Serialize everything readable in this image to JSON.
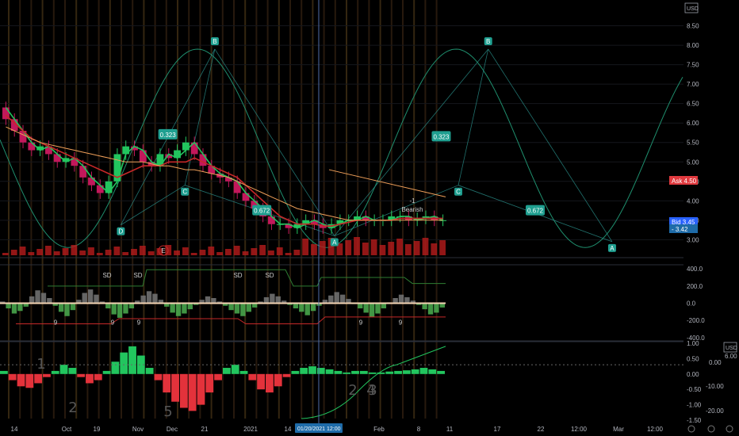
{
  "header": {
    "currency": "USD",
    "pane_currency": "USD"
  },
  "chart_data": [
    {
      "type": "candlestick",
      "pane": "price",
      "ylim": [
        2.6,
        9.0
      ],
      "y_ticks": [
        "8.50",
        "8.00",
        "7.50",
        "7.00",
        "6.50",
        "6.00",
        "5.50",
        "5.00",
        "4.50",
        "4.00",
        "3.50",
        "3.00"
      ],
      "x_ticks": [
        "14",
        "Oct",
        "19",
        "Nov",
        "Dec",
        "21",
        "2021",
        "14",
        "Feb",
        "8",
        "11",
        "17",
        "22",
        "12:00",
        "Mar",
        "12:00"
      ],
      "crosshair_time_label": "01/20/2021 12:00",
      "price_tags": [
        {
          "label": "Ask",
          "value": "4.50",
          "color": "#e0393e"
        },
        {
          "label": "Bid",
          "value": "3.45",
          "color": "#2962ff"
        },
        {
          "label": "",
          "value": "3.42",
          "color": "#1e6ba8"
        }
      ],
      "harmonic_points": [
        {
          "label": "D",
          "x": 0.16,
          "y": 3.38
        },
        {
          "label": "B",
          "x": 0.27,
          "y": 7.9
        },
        {
          "label": "C",
          "x": 0.235,
          "y": 4.4
        },
        {
          "label": "A",
          "x": 0.41,
          "y": 3.1
        },
        {
          "label": "C",
          "x": 0.555,
          "y": 4.4
        },
        {
          "label": "B",
          "x": 0.59,
          "y": 7.9
        },
        {
          "label": "A",
          "x": 0.735,
          "y": 2.95
        }
      ],
      "ratios": [
        {
          "value": "0.323",
          "x": 0.215,
          "y": 5.7
        },
        {
          "value": "0.672",
          "x": 0.325,
          "y": 3.75
        },
        {
          "value": "0.323",
          "x": 0.535,
          "y": 5.65
        },
        {
          "value": "0.672",
          "x": 0.645,
          "y": 3.75
        }
      ],
      "annotations": {
        "bearish_count": "-1",
        "bearish_label": "Bearish",
        "circle_label": "E"
      },
      "series": [
        {
          "name": "",
          "values": [
            6.4,
            6.1,
            5.8,
            5.5,
            5.3,
            5.4,
            5.2,
            5.0,
            5.1,
            4.9,
            4.6,
            4.4,
            4.2,
            4.5,
            5.2,
            5.4,
            5.3,
            5.0,
            4.9,
            5.2,
            5.1,
            5.3,
            5.5,
            5.2,
            4.9,
            4.7,
            4.6,
            4.5,
            4.2,
            4.0,
            3.8,
            3.6,
            3.4,
            3.4,
            3.3,
            3.4,
            3.5,
            3.4,
            3.3,
            3.4,
            3.5,
            3.5,
            3.6,
            3.5,
            3.5,
            3.5,
            3.6,
            3.6,
            3.5,
            3.55,
            3.6,
            3.5
          ]
        },
        {
          "name": "",
          "values": [
            6.2,
            6.0,
            5.8,
            5.6,
            5.5,
            5.4,
            5.3,
            5.2,
            5.1,
            5.0,
            4.9,
            4.8,
            4.7,
            4.6,
            4.7,
            4.8,
            4.9,
            4.9,
            4.9,
            5.0,
            5.0,
            5.0,
            5.1,
            5.0,
            4.9,
            4.8,
            4.7,
            4.6,
            4.4,
            4.2,
            4.0,
            3.8,
            3.6,
            3.5,
            3.4,
            3.4,
            3.4,
            3.35,
            3.35,
            3.4,
            3.45,
            3.5,
            3.5,
            3.5,
            3.5,
            3.5,
            3.55,
            3.55,
            3.55,
            3.55,
            3.55,
            3.55
          ]
        },
        {
          "name": "",
          "values": [
            5.9,
            5.8,
            5.7,
            5.6,
            5.5,
            5.45,
            5.4,
            5.35,
            5.3,
            5.25,
            5.2,
            5.15,
            5.1,
            5.05,
            5.0,
            5.0,
            5.0,
            4.95,
            4.9,
            4.9,
            4.85,
            4.8,
            4.8,
            4.75,
            4.7,
            4.65,
            4.6,
            4.5,
            4.4,
            4.3,
            4.2,
            4.1,
            4.0,
            3.9,
            3.8,
            3.75,
            3.7,
            3.65,
            3.6,
            3.55,
            3.5,
            3.5,
            3.5,
            3.5,
            3.5,
            3.5,
            3.5,
            3.5,
            3.5,
            3.5,
            3.5,
            3.5
          ]
        }
      ]
    },
    {
      "type": "bar",
      "pane": "oscillator",
      "ylim": [
        -420,
        420
      ],
      "y_ticks": [
        "400.0",
        "200.0",
        "0.0",
        "-200.0",
        "-400.0"
      ],
      "signal_labels": [
        "SD",
        "SD",
        "SD",
        "SD",
        "9",
        "9",
        "9",
        "9",
        "9"
      ],
      "values": [
        20,
        -60,
        -120,
        -90,
        -40,
        80,
        150,
        120,
        60,
        -30,
        -100,
        -150,
        -80,
        40,
        120,
        160,
        100,
        20,
        -60,
        -130,
        -170,
        -120,
        -60,
        30,
        90,
        140,
        110,
        40,
        -40,
        -110,
        -150,
        -120,
        -70,
        -20,
        40,
        80,
        60,
        20,
        -30,
        -80,
        -120,
        -150,
        -100,
        -50,
        20,
        70,
        110,
        80,
        30,
        -20,
        -60,
        -100,
        -140,
        -90,
        -30,
        40,
        90,
        130,
        100,
        50,
        -10,
        -60,
        -110,
        -160,
        -120,
        -60,
        10,
        60,
        100,
        70,
        30,
        -20,
        -70,
        -130,
        -110,
        -50
      ]
    },
    {
      "type": "bar",
      "pane": "momentum",
      "ylim": [
        -1.5,
        1.0
      ],
      "y_ticks": [
        "1.00",
        "0.50",
        "0.00",
        "-0.50",
        "-1.00",
        "-1.50"
      ],
      "right_ticks": [
        "0.00",
        "-10.00",
        "-20.00"
      ],
      "right_top_label": "6.00",
      "wave_labels": [
        "1",
        "2",
        "5",
        "2",
        "4",
        "3"
      ],
      "values": [
        0.1,
        -0.2,
        -0.4,
        -0.45,
        -0.3,
        -0.1,
        0.1,
        0.3,
        0.2,
        -0.1,
        -0.3,
        -0.2,
        0.1,
        0.4,
        0.7,
        0.9,
        0.6,
        0.2,
        -0.2,
        -0.6,
        -0.9,
        -1.1,
        -1.2,
        -1.0,
        -0.6,
        -0.2,
        0.2,
        0.3,
        0.1,
        -0.2,
        -0.5,
        -0.6,
        -0.4,
        -0.1,
        0.1,
        0.2,
        0.25,
        0.2,
        0.15,
        0.1,
        0.05,
        0.1,
        0.1,
        0.05,
        0.05,
        0.08,
        0.1,
        0.12,
        0.15,
        0.2,
        0.15,
        0.1
      ]
    }
  ],
  "colors": {
    "background": "#000000",
    "bull": "#26a69a",
    "bear": "#ef5350",
    "green": "#22c55e",
    "red": "#e3323b",
    "orange": "#f0a05a",
    "teal": "#2aa198",
    "crosshair": "#4f6ea8"
  }
}
